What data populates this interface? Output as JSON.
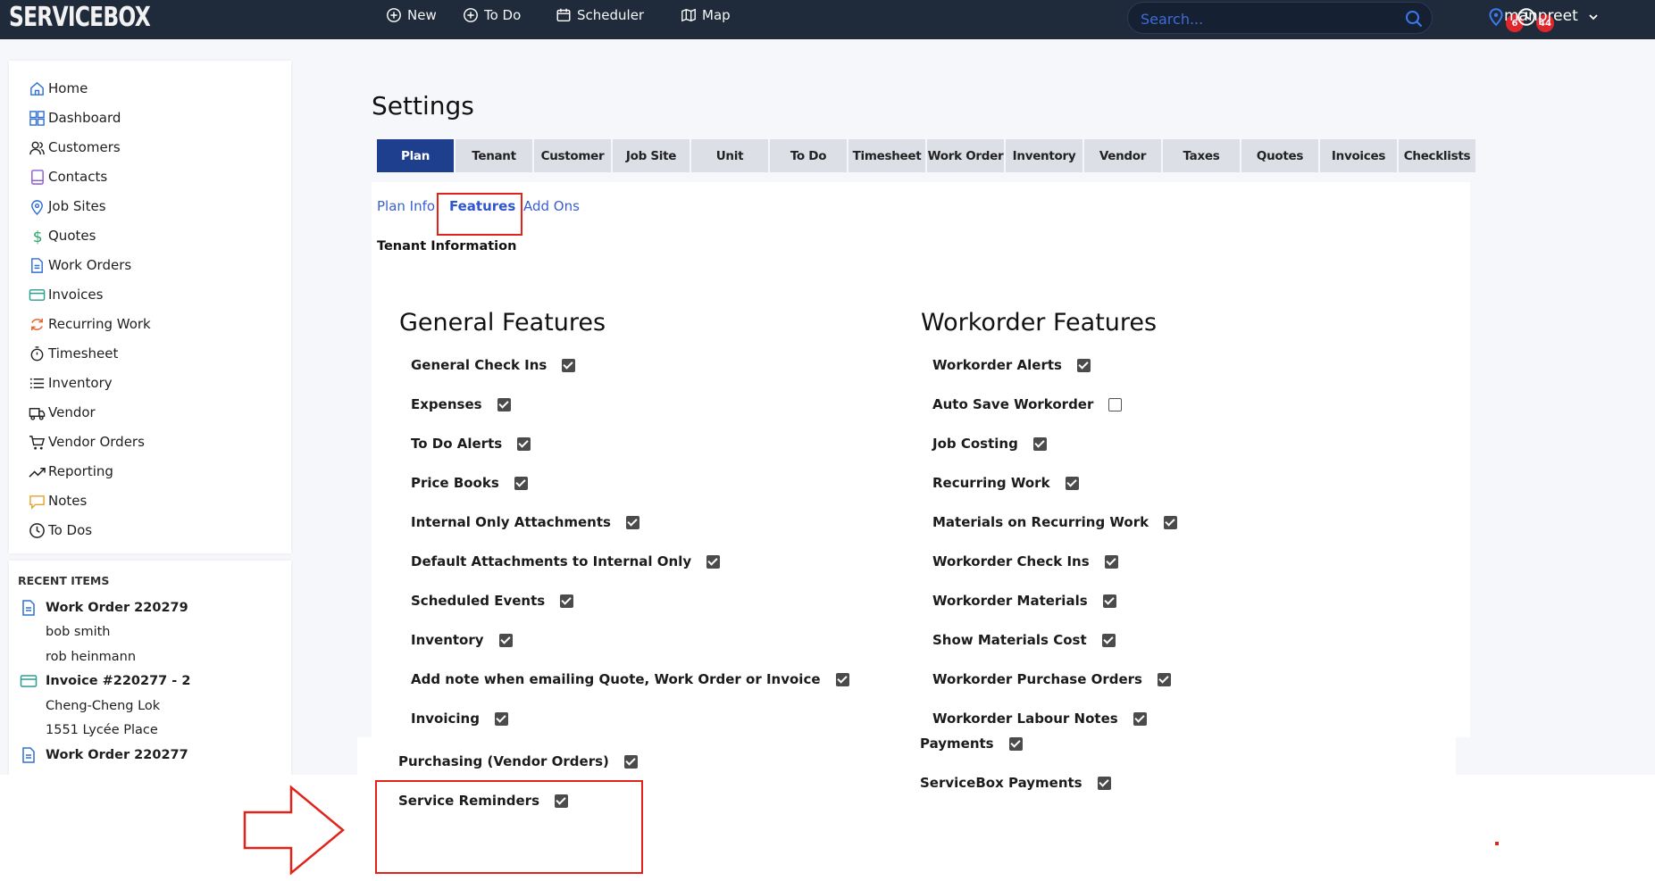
{
  "header": {
    "logo": "SERVICEBOX",
    "nav": [
      {
        "label": "New",
        "icon": "plus-circle-icon"
      },
      {
        "label": "To Do",
        "icon": "plus-circle-icon"
      },
      {
        "label": "Scheduler",
        "icon": "calendar-icon"
      },
      {
        "label": "Map",
        "icon": "map-icon"
      }
    ],
    "search_placeholder": "Search...",
    "location_badge": "6",
    "clock_badge": "44",
    "username": "manpreet"
  },
  "sidebar": {
    "items": [
      {
        "label": "Home",
        "icon": "home-icon"
      },
      {
        "label": "Dashboard",
        "icon": "dashboard-icon"
      },
      {
        "label": "Customers",
        "icon": "users-icon"
      },
      {
        "label": "Contacts",
        "icon": "contact-card-icon"
      },
      {
        "label": "Job Sites",
        "icon": "location-pin-icon"
      },
      {
        "label": "Quotes",
        "icon": "dollar-icon"
      },
      {
        "label": "Work Orders",
        "icon": "document-icon"
      },
      {
        "label": "Invoices",
        "icon": "credit-card-icon"
      },
      {
        "label": "Recurring Work",
        "icon": "recurring-icon"
      },
      {
        "label": "Timesheet",
        "icon": "stopwatch-icon"
      },
      {
        "label": "Inventory",
        "icon": "list-icon"
      },
      {
        "label": "Vendor",
        "icon": "truck-icon"
      },
      {
        "label": "Vendor Orders",
        "icon": "cart-icon"
      },
      {
        "label": "Reporting",
        "icon": "trending-up-icon"
      },
      {
        "label": "Notes",
        "icon": "note-icon"
      },
      {
        "label": "To Dos",
        "icon": "clock-icon"
      }
    ]
  },
  "recent": {
    "title": "RECENT ITEMS",
    "items": [
      {
        "label": "Work Order 220279",
        "head": true,
        "icon": "document-icon"
      },
      {
        "label": "bob smith",
        "head": false
      },
      {
        "label": "rob heinmann",
        "head": false
      },
      {
        "label": "Invoice #220277 - 2",
        "head": true,
        "icon": "credit-card-icon"
      },
      {
        "label": "Cheng-Cheng Lok",
        "head": false
      },
      {
        "label": "1551 Lycée Place",
        "head": false
      },
      {
        "label": "Work Order 220277",
        "head": true,
        "icon": "document-icon"
      }
    ]
  },
  "main": {
    "title": "Settings",
    "tabs": [
      "Plan",
      "Tenant",
      "Customer",
      "Job Site",
      "Unit",
      "To Do",
      "Timesheet",
      "Work Order",
      "Inventory",
      "Vendor",
      "Taxes",
      "Quotes",
      "Invoices",
      "Checklists"
    ],
    "active_tab": "Plan",
    "subtabs": [
      "Plan Info",
      "Features",
      "Add Ons"
    ],
    "active_subtab": "Features",
    "section_label": "Tenant Information",
    "general": {
      "heading": "General Features",
      "items": [
        {
          "label": "General Check Ins",
          "checked": true
        },
        {
          "label": "Expenses",
          "checked": true
        },
        {
          "label": "To Do Alerts",
          "checked": true
        },
        {
          "label": "Price Books",
          "checked": true
        },
        {
          "label": "Internal Only Attachments",
          "checked": true
        },
        {
          "label": "Default Attachments to Internal Only",
          "checked": true
        },
        {
          "label": "Scheduled Events",
          "checked": true
        },
        {
          "label": "Inventory",
          "checked": true
        },
        {
          "label": "Add note when emailing Quote, Work Order or Invoice",
          "checked": true
        },
        {
          "label": "Invoicing",
          "checked": true
        },
        {
          "label": "Purchasing (Vendor Orders)",
          "checked": true
        },
        {
          "label": "Service Reminders",
          "checked": true
        }
      ]
    },
    "workorder": {
      "heading": "Workorder Features",
      "items": [
        {
          "label": "Workorder Alerts",
          "checked": true
        },
        {
          "label": "Auto Save Workorder",
          "checked": false
        },
        {
          "label": "Job Costing",
          "checked": true
        },
        {
          "label": "Recurring Work",
          "checked": true
        },
        {
          "label": "Materials on Recurring Work",
          "checked": true
        },
        {
          "label": "Workorder Check Ins",
          "checked": true
        },
        {
          "label": "Workorder Materials",
          "checked": true
        },
        {
          "label": "Show Materials Cost",
          "checked": true
        },
        {
          "label": "Workorder Purchase Orders",
          "checked": true
        },
        {
          "label": "Workorder Labour Notes",
          "checked": true
        },
        {
          "label": "Payments",
          "checked": true
        },
        {
          "label": "ServiceBox Payments",
          "checked": true
        }
      ]
    }
  },
  "colors": {
    "header_bg": "#1f2a3a",
    "active_tab": "#1e3f8e",
    "link": "#3a5fcf",
    "annotation_red": "#e2231a",
    "badge_red": "#e0262d"
  }
}
